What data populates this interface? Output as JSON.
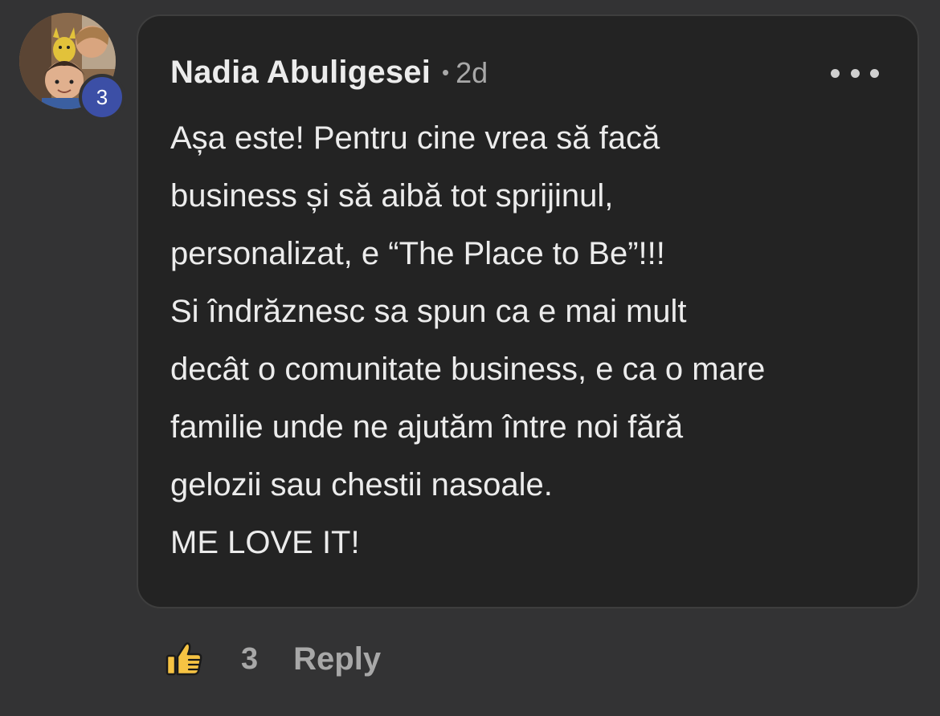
{
  "comment": {
    "author": "Nadia Abuligesei",
    "separator": "•",
    "time": "2d",
    "level_badge": "3",
    "text_lines": [
      "Așa este! Pentru cine vrea să facă",
      "business și să aibă tot sprijinul,",
      "personalizat, e “The Place to Be”!!!",
      "Si îndrăznesc sa spun ca e mai mult",
      "decât o comunitate business, e ca o mare",
      "familie unde ne ajutăm între noi fără",
      "gelozii sau chestii nasoale.",
      "ME LOVE IT!"
    ],
    "more_icon": "more-horizontal-icon"
  },
  "actions": {
    "like_icon": "thumbs-up-icon",
    "like_count": "3",
    "reply_label": "Reply"
  },
  "colors": {
    "background": "#333334",
    "bubble": "#232323",
    "badge": "#3c4fa6",
    "like_icon": "#f6c343",
    "text": "#ececec",
    "muted": "#a8a8a8"
  }
}
